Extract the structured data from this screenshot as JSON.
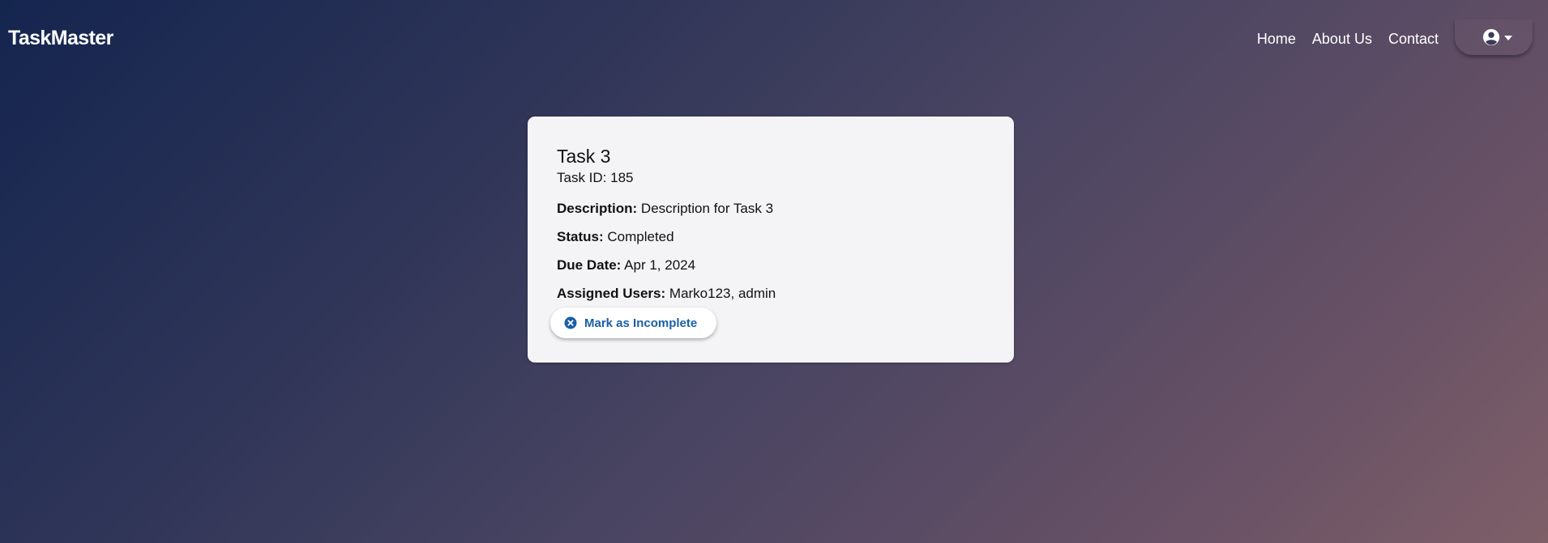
{
  "nav": {
    "brand": "TaskMaster",
    "links": [
      {
        "label": "Home"
      },
      {
        "label": "About Us"
      },
      {
        "label": "Contact"
      }
    ],
    "account_icon": "account-circle-icon",
    "caret_icon": "caret-down-icon"
  },
  "task": {
    "title": "Task 3",
    "id_text": "Task ID: 185",
    "description_label": "Description:",
    "description": "Description for Task 3",
    "status_label": "Status:",
    "status": "Completed",
    "due_label": "Due Date:",
    "due_date": "Apr 1, 2024",
    "users_label": "Assigned Users:",
    "users": "Marko123, admin",
    "action_label": "Mark as Incomplete",
    "action_icon": "close-circle-icon"
  },
  "colors": {
    "accent": "#1a5fa8",
    "card_bg": "#f4f4f6",
    "gradient_start": "#14254f",
    "gradient_end": "#7e5f68"
  }
}
